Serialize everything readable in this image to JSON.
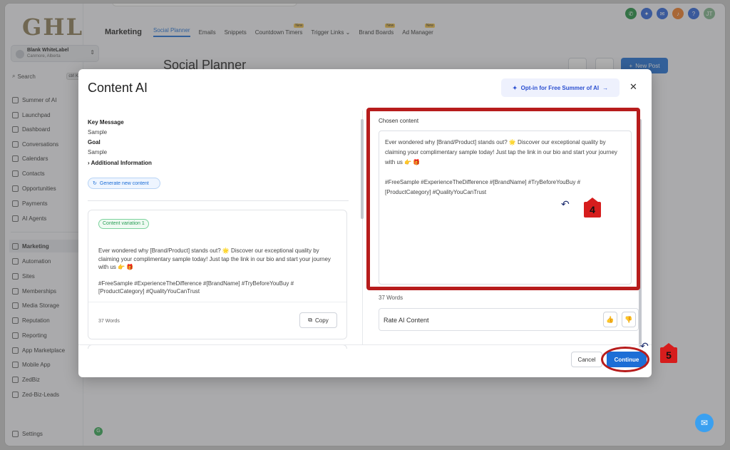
{
  "logo": "GHL",
  "account": {
    "name": "Blank WhiteLabel",
    "location": "Canmore, Alberta"
  },
  "search": {
    "label": "Search",
    "shortcut": "ctrl K"
  },
  "sidebar": {
    "items": [
      {
        "label": "Summer of AI"
      },
      {
        "label": "Launchpad"
      },
      {
        "label": "Dashboard"
      },
      {
        "label": "Conversations"
      },
      {
        "label": "Calendars"
      },
      {
        "label": "Contacts"
      },
      {
        "label": "Opportunities"
      },
      {
        "label": "Payments"
      },
      {
        "label": "AI Agents"
      },
      {
        "label": "Marketing"
      },
      {
        "label": "Automation"
      },
      {
        "label": "Sites"
      },
      {
        "label": "Memberships"
      },
      {
        "label": "Media Storage"
      },
      {
        "label": "Reputation"
      },
      {
        "label": "Reporting"
      },
      {
        "label": "App Marketplace"
      },
      {
        "label": "Mobile App"
      },
      {
        "label": "ZedBiz"
      },
      {
        "label": "Zed-Biz-Leads"
      }
    ],
    "settings": "Settings",
    "settings_badge": "G"
  },
  "topnav": {
    "title": "Marketing",
    "tabs": [
      {
        "label": "Social Planner",
        "tag": ""
      },
      {
        "label": "Emails",
        "tag": ""
      },
      {
        "label": "Snippets",
        "tag": ""
      },
      {
        "label": "Countdown Timers",
        "tag": "New"
      },
      {
        "label": "Trigger Links",
        "tag": ""
      },
      {
        "label": "Brand Boards",
        "tag": "New"
      },
      {
        "label": "Ad Manager",
        "tag": "New"
      }
    ],
    "user_initials": "JT"
  },
  "page": {
    "title": "Social Planner",
    "new_post": "New Post"
  },
  "modal": {
    "title": "Content AI",
    "optin": "Opt-in for Free Summer of AI",
    "key_message_label": "Key Message",
    "key_message_value": "Sample",
    "goal_label": "Goal",
    "goal_value": "Sample",
    "additional_info": "Additional Information",
    "generate_button": "Generate new content",
    "variation": {
      "tag": "Content variation 1",
      "text": "Ever wondered why [Brand/Product] stands out? 🌟 Discover our exceptional quality by claiming your complimentary sample today! Just tap the link in our bio and start your journey with us 👉 🎁",
      "hashtags": "#FreeSample #ExperienceTheDifference #[BrandName] #TryBeforeYouBuy #[ProductCategory] #QualityYouCanTrust",
      "words": "37 Words",
      "copy": "Copy"
    },
    "chosen": {
      "label": "Chosen content",
      "text": "Ever wondered why [Brand/Product] stands out? 🌟 Discover our exceptional quality by claiming your complimentary sample today! Just tap the link in our bio and start your journey with us 👉 🎁",
      "hashtags": "#FreeSample #ExperienceTheDifference #[BrandName] #TryBeforeYouBuy #[ProductCategory] #QualityYouCanTrust",
      "words": "37 Words"
    },
    "rate_label": "Rate AI Content",
    "cancel": "Cancel",
    "continue": "Continue"
  },
  "annotations": {
    "step4": "4",
    "step5": "5"
  },
  "colors": {
    "primary": "#1d6ed6",
    "highlight": "#b71c1c"
  }
}
